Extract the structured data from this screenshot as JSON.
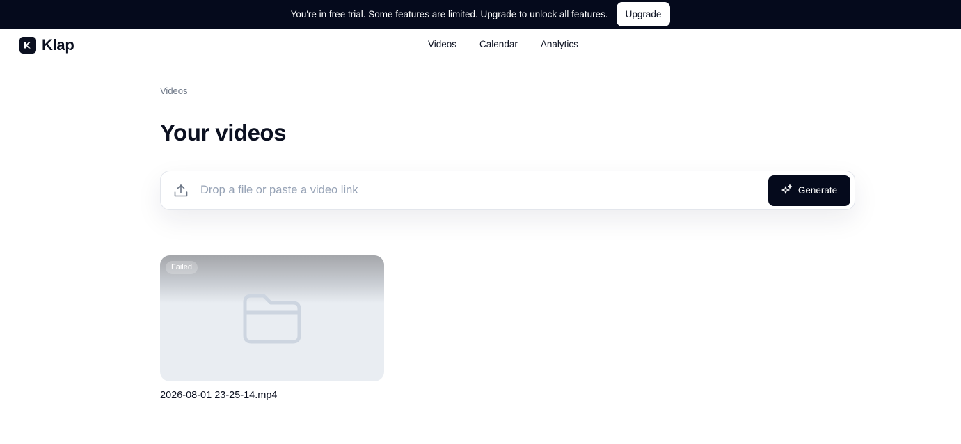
{
  "banner": {
    "message": "You're in free trial. Some features are limited. Upgrade to unlock all features.",
    "upgrade_label": "Upgrade"
  },
  "brand": {
    "name": "Klap",
    "logo_icon": "klap-logo-icon"
  },
  "nav": {
    "items": [
      {
        "label": "Videos"
      },
      {
        "label": "Calendar"
      },
      {
        "label": "Analytics"
      }
    ]
  },
  "breadcrumb": "Videos",
  "page_title": "Your videos",
  "upload": {
    "icon": "upload-icon",
    "placeholder": "Drop a file or paste a video link",
    "value": "",
    "generate_label": "Generate",
    "generate_icon": "sparkle-icon"
  },
  "videos": [
    {
      "status": "Failed",
      "thumbnail_icon": "folder-icon",
      "filename": "2026-08-01 23-25-14.mp4"
    }
  ],
  "colors": {
    "banner_bg": "#050a1c",
    "primary_button": "#050a1c",
    "placeholder": "#97a3b6",
    "breadcrumb": "#6b7585",
    "thumbnail_bg": "#e9edf2",
    "folder_stroke": "#cdd5e0"
  }
}
